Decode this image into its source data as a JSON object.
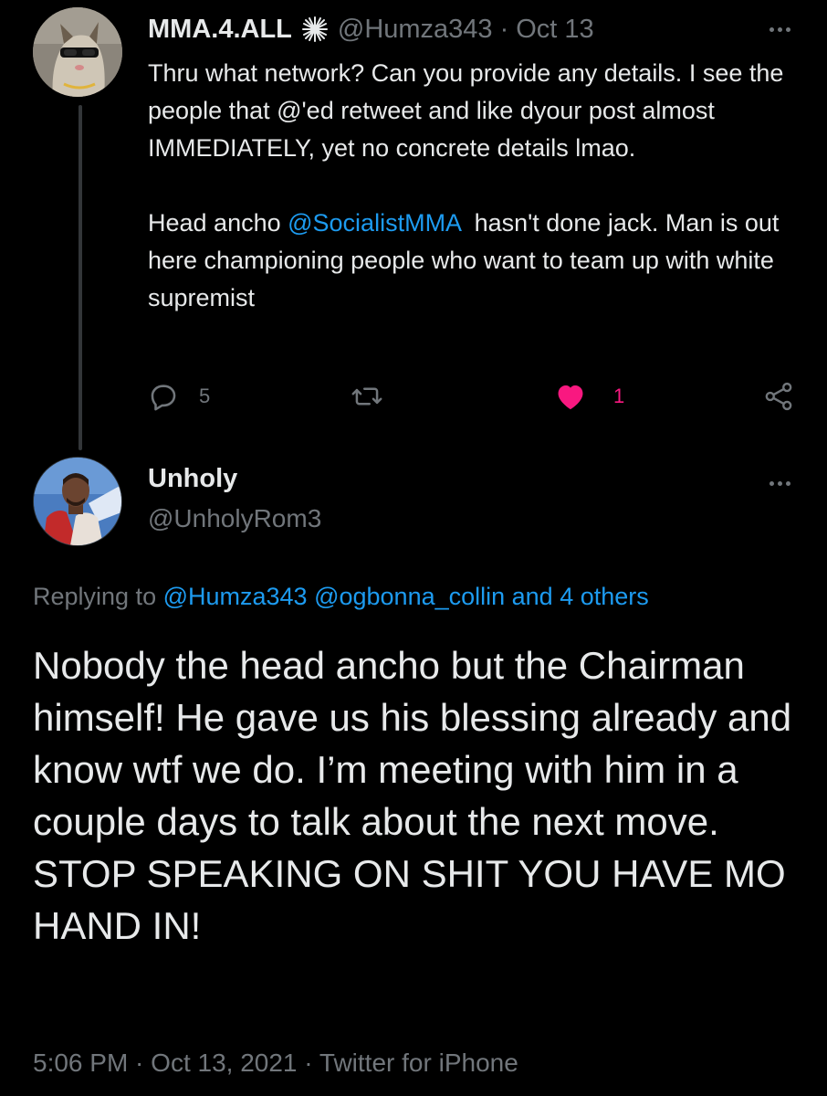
{
  "colors": {
    "background": "#000000",
    "text": "#e7e9ea",
    "secondary": "#71767b",
    "link": "#1d9bf0",
    "like": "#f91880"
  },
  "parent_tweet": {
    "display_name": "MMA.4.ALL",
    "badge_icon": "starburst-icon",
    "handle": "@Humza343",
    "separator": "·",
    "date": "Oct 13",
    "body_line1": "Thru what network? Can you provide any details. I see the people that @'ed retweet and like dyour post almost IMMEDIATELY, yet no concrete details lmao.",
    "body_line2_before": "Head ancho ",
    "body_line2_mention": "@SocialistMMA",
    "body_line2_after": "  hasn't done jack. Man is out here championing people who want to team up with white supremist",
    "reply_count": "5",
    "retweet_count": "",
    "like_count": "1",
    "liked": true
  },
  "main_tweet": {
    "display_name": "Unholy",
    "handle": "@UnholyRom3",
    "replying_label": "Replying to ",
    "replying_mentions": "@Humza343 @ogbonna_collin and 4 others",
    "text": "Nobody the head ancho but the Chairman himself! He gave us his blessing already and know wtf we do. I’m meeting with him in a couple days to talk about the next move. STOP SPEAKING ON SHIT YOU HAVE MO HAND IN!",
    "time": "5:06 PM",
    "separator": " · ",
    "date": "Oct 13, 2021",
    "source": "Twitter for iPhone"
  }
}
